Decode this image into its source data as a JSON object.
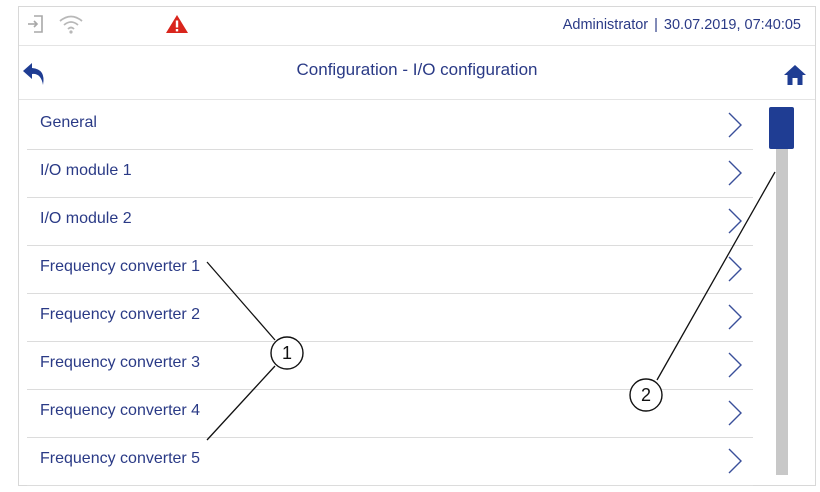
{
  "status": {
    "user": "Administrator",
    "separator": "|",
    "datetime": "30.07.2019, 07:40:05",
    "icons": [
      "login-icon",
      "wifi-icon",
      "warning-icon"
    ],
    "warning_color": "#d9251c"
  },
  "header": {
    "title": "Configuration - I/O configuration",
    "back_icon": "back-arrow-icon",
    "home_icon": "home-icon"
  },
  "list": {
    "items": [
      {
        "label": "General"
      },
      {
        "label": "I/O module 1"
      },
      {
        "label": "I/O module 2"
      },
      {
        "label": "Frequency converter 1"
      },
      {
        "label": "Frequency converter 2"
      },
      {
        "label": "Frequency converter 3"
      },
      {
        "label": "Frequency converter 4"
      },
      {
        "label": "Frequency converter 5"
      }
    ]
  },
  "scrollbar": {
    "position": 0
  },
  "callouts": [
    {
      "number": "1"
    },
    {
      "number": "2"
    }
  ],
  "colors": {
    "accent": "#1f3d93",
    "text": "#2a3a86",
    "track": "#c8c8c8"
  }
}
